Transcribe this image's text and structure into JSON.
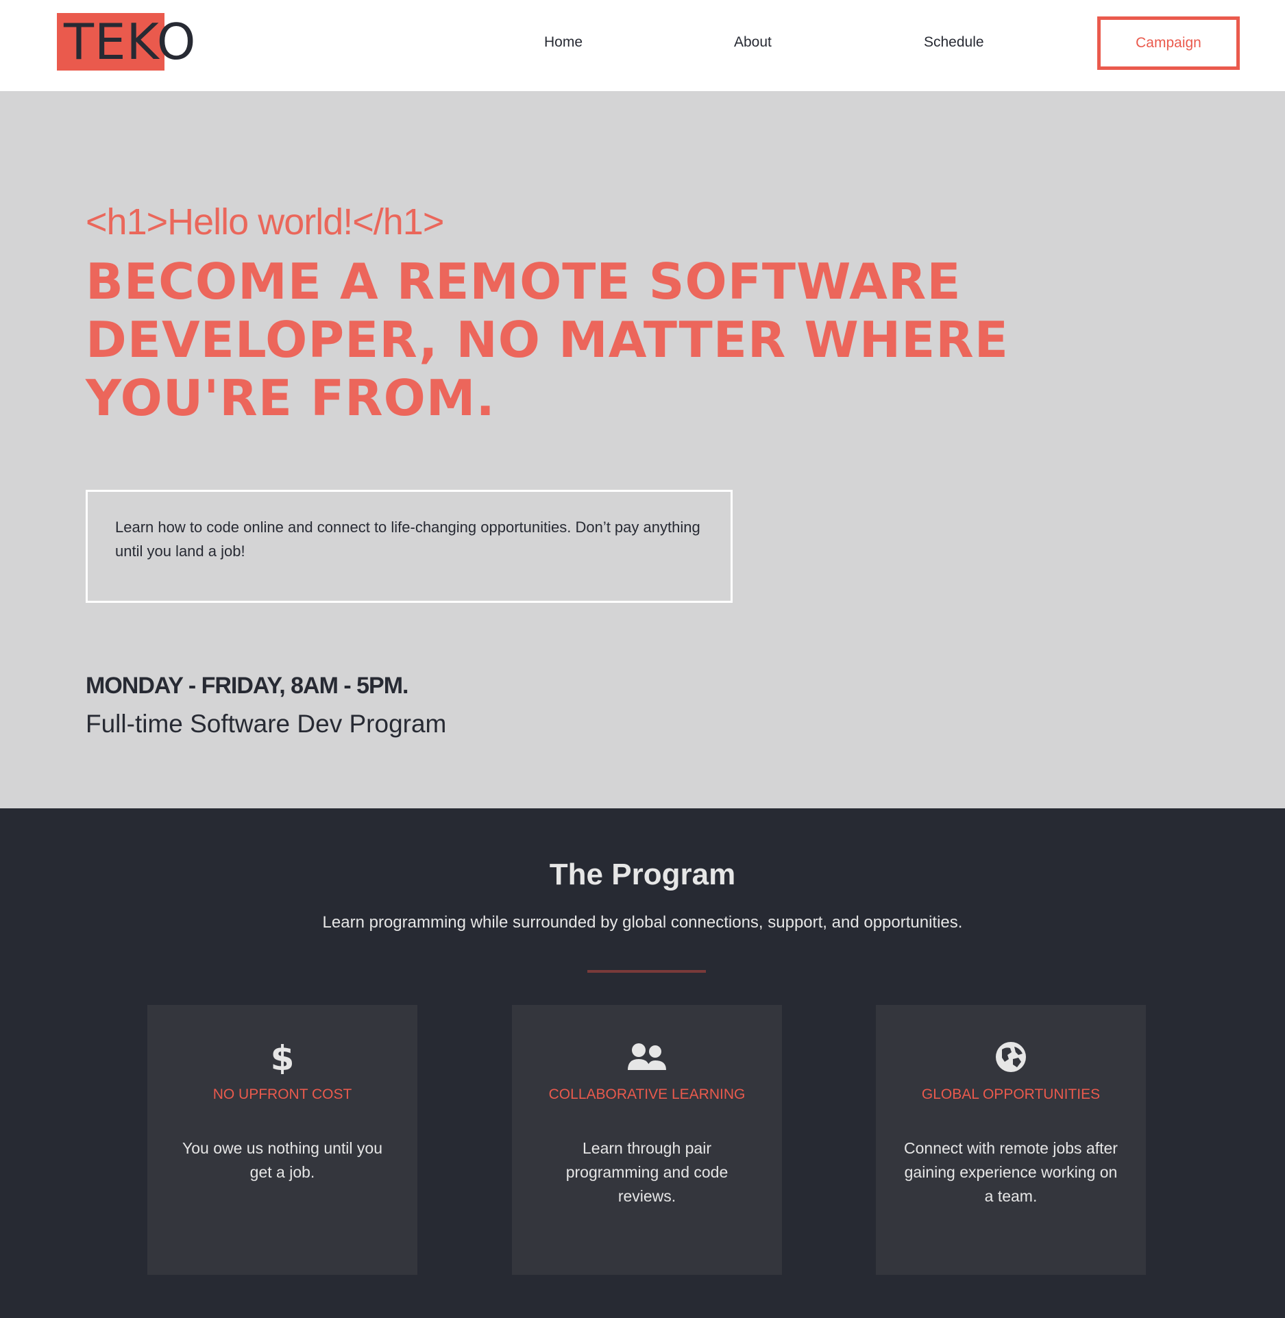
{
  "header": {
    "logo_text": "TEKO",
    "nav": {
      "home": "Home",
      "about": "About",
      "schedule": "Schedule"
    },
    "cta_label": "Campaign"
  },
  "hero": {
    "code_line": "<h1>Hello world!</h1>",
    "title": "BECOME A REMOTE SOFTWARE DEVELOPER, NO MATTER WHERE YOU'RE FROM.",
    "intro": "Learn how to code online and connect to life-changing opportunities. Don’t pay anything until you land a job!",
    "days": "MONDAY - FRIDAY, 8AM - 5PM.",
    "program": "Full-time Software Dev Program"
  },
  "program": {
    "title": "The Program",
    "subtitle": "Learn programming while surrounded by global connections, support, and opportunities.",
    "cards": [
      {
        "icon": "dollar-icon",
        "title": "NO UPFRONT COST",
        "text": "You owe us nothing until you get a job."
      },
      {
        "icon": "users-icon",
        "title": "COLLABORATIVE LEARNING",
        "text": "Learn through pair programming and code reviews."
      },
      {
        "icon": "globe-icon",
        "title": "GLOBAL OPPORTUNITIES",
        "text": "Connect with remote jobs after gaining experience working on a team."
      }
    ]
  },
  "colors": {
    "accent": "#ea5a4d",
    "hero_bg": "#d4d4d5",
    "dark_bg": "#272a33",
    "card_bg": "#34363d"
  }
}
